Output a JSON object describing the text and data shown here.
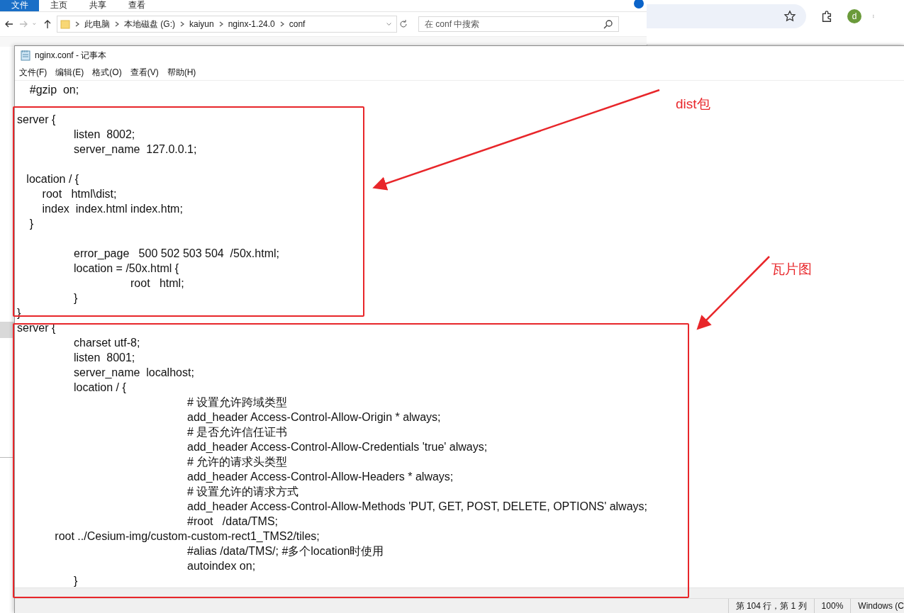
{
  "explorer": {
    "ribbon_tabs": [
      {
        "label": "文件",
        "selected": true
      },
      {
        "label": "主页",
        "selected": false
      },
      {
        "label": "共享",
        "selected": false
      },
      {
        "label": "查看",
        "selected": false
      }
    ],
    "breadcrumbs": [
      "此电脑",
      "本地磁盘 (G:)",
      "kaiyun",
      "nginx-1.24.0",
      "conf"
    ],
    "search": {
      "placeholder": "在 conf 中搜索"
    }
  },
  "browser": {
    "profile_initial": "d"
  },
  "notepad": {
    "title": "nginx.conf - 记事本",
    "menu": [
      "文件(F)",
      "编辑(E)",
      "格式(O)",
      "查看(V)",
      "帮助(H)"
    ],
    "paragraphs": [
      [
        "    #gzip  on;"
      ],
      [
        "server {",
        "\tlisten  8002;",
        "\tserver_name  127.0.0.1;"
      ],
      [
        "   location / {",
        "        root   html\\dist;",
        "        index  index.html index.htm;",
        "    }"
      ],
      [
        "\terror_page   500 502 503 504  /50x.html;",
        "\tlocation = /50x.html {",
        "\t\troot   html;",
        "\t}",
        "}",
        "server {",
        "\tcharset utf-8;",
        "\tlisten  8001;",
        "\tserver_name  localhost;",
        "\tlocation / {",
        "\t\t\t# 设置允许跨域类型",
        "\t\t\tadd_header Access-Control-Allow-Origin * always;",
        "\t\t\t# 是否允许信任证书",
        "\t\t\tadd_header Access-Control-Allow-Credentials 'true' always;",
        "\t\t\t# 允许的请求头类型",
        "\t\t\tadd_header Access-Control-Allow-Headers * always;",
        "\t\t\t# 设置允许的请求方式",
        "\t\t\tadd_header Access-Control-Allow-Methods 'PUT, GET, POST, DELETE, OPTIONS' always;",
        "\t\t\t#root   /data/TMS;",
        "            root ../Cesium-img/custom-custom-rect1_TMS2/tiles;",
        "\t\t\t#alias /data/TMS/; #多个location时使用",
        "\t\t\tautoindex on;",
        "\t}"
      ]
    ],
    "status_bar": {
      "position": "第 104 行，第 1 列",
      "zoom": "100%",
      "line_ending": "Windows (C"
    }
  },
  "annotations": [
    {
      "label": "dist包"
    },
    {
      "label": "瓦片图"
    }
  ]
}
